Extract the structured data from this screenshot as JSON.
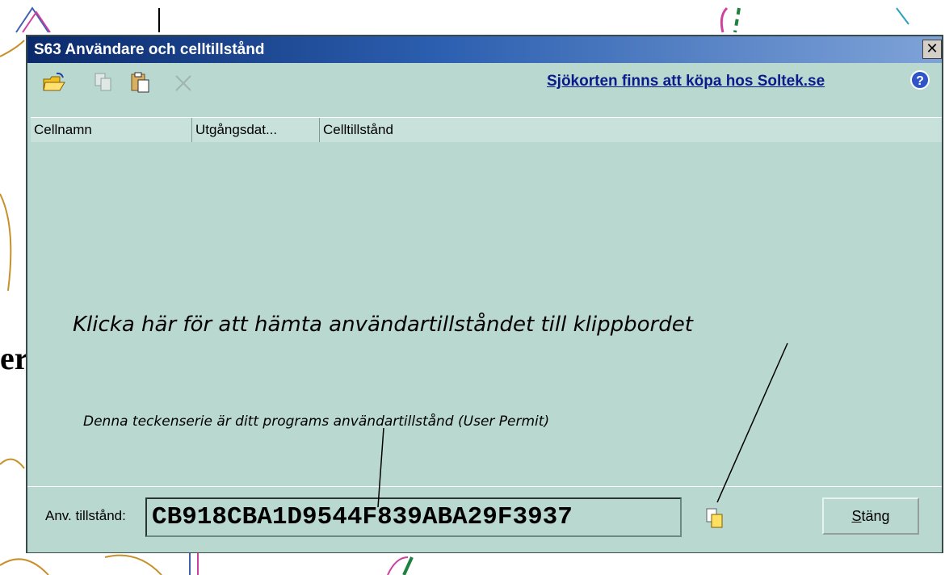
{
  "window": {
    "title": "S63  Användare och celltillstånd",
    "close_glyph": "✕"
  },
  "toolbar": {
    "icons": [
      "open-folder-icon",
      "copy-icon",
      "paste-icon",
      "delete-icon"
    ],
    "link_text": "Sjökorten finns att köpa hos Soltek.se",
    "help_icon": "help-icon"
  },
  "table": {
    "columns": [
      "Cellnamn",
      "Utgångsdat...",
      "Celltillstånd"
    ],
    "rows": []
  },
  "permit": {
    "label": "Anv. tillstånd:",
    "value": "CB918CBA1D9544F839ABA29F3937",
    "copy_icon": "copy-to-clipboard-icon"
  },
  "buttons": {
    "close_label_prefix": "S",
    "close_label_rest": "täng"
  },
  "annotations": {
    "main": "Klicka här för att hämta användartillståndet till klippbordet",
    "sub": "Denna teckenserie är  ditt programs användartillstånd (User Permit)"
  },
  "background": {
    "map_text": "er"
  },
  "colors": {
    "dialog_bg": "#b9d8d0",
    "title_start": "#0b2a6b",
    "link": "#0b1b8a"
  }
}
